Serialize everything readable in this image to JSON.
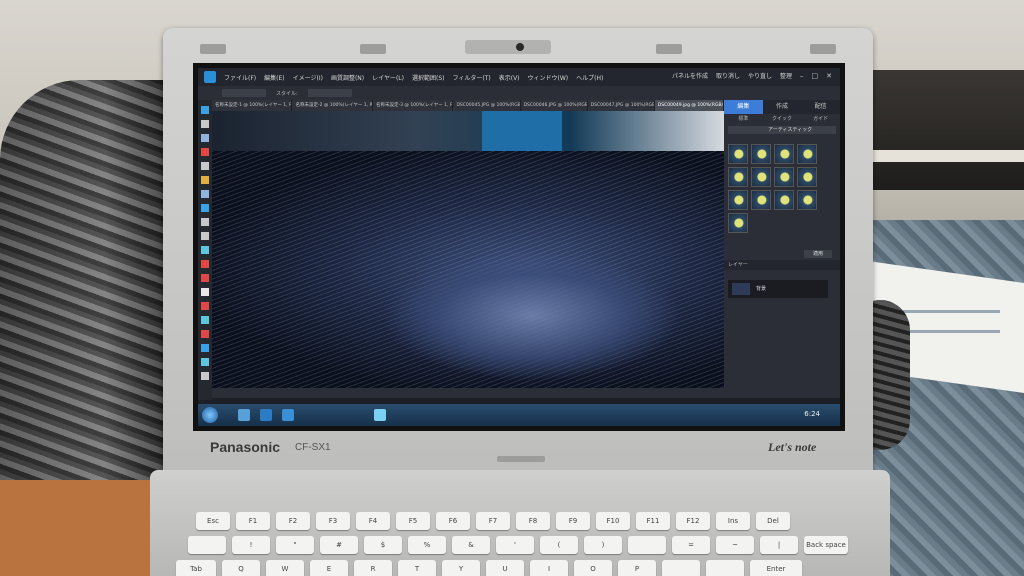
{
  "screen": {
    "menu": [
      "ファイル(F)",
      "編集(E)",
      "イメージ(I)",
      "画質調整(N)",
      "レイヤー(L)",
      "選択範囲(S)",
      "フィルター(T)",
      "表示(V)",
      "ウィンドウ(W)",
      "ヘルプ(H)"
    ],
    "right_menu": [
      "パネルを作成",
      "取り消し",
      "やり直し",
      "整理"
    ],
    "window_controls": [
      "–",
      "□",
      "✕"
    ],
    "options": {
      "mode": "",
      "style_label": "スタイル:",
      "style_value": ""
    },
    "tabs": [
      "名称未設定-1 @ 100%(レイヤー 1, RG",
      "名称未設定-2 @ 100%(レイヤー 1, RG",
      "名称未設定-3 @ 100%(レイヤー 1, RG",
      "DSC00045.JPG @ 100%(RGB/",
      "DSC00046.JPG @ 100%(RGB/",
      "DSC00047.JPG @ 100%(RGB/",
      "DSC00049.jpg @ 100%(RGB/8"
    ],
    "active_tab_index": 6,
    "status_text": "",
    "panel": {
      "tabs": [
        "編集",
        "作成",
        "配信"
      ],
      "active_tab": "編集",
      "subtabs": [
        "標準",
        "クイック",
        "ガイド"
      ],
      "effects_select": "アーティスティック",
      "apply_button": "適用",
      "layers_label": "レイヤー",
      "layer_name": "背景"
    },
    "clock": "6:24"
  },
  "laptop": {
    "brand": "Panasonic",
    "model": "CF-SX1",
    "series": "Let's note"
  },
  "keyboard": {
    "row1": [
      "Esc",
      "F1",
      "F2",
      "F3",
      "F4",
      "F5",
      "F6",
      "F7",
      "F8",
      "F9",
      "F10",
      "F11",
      "F12",
      "Ins",
      "Del"
    ],
    "row2": [
      "",
      "!",
      "\"",
      "#",
      "$",
      "%",
      "&",
      "'",
      "(",
      ")",
      "",
      "=",
      "~",
      "|",
      "Back space"
    ],
    "row3": [
      "Tab",
      "Q",
      "W",
      "E",
      "R",
      "T",
      "Y",
      "U",
      "I",
      "O",
      "P",
      "",
      "",
      "Enter"
    ]
  },
  "colors": {
    "screen_bg": "#1c1f26",
    "accent": "#3d7dd8"
  }
}
